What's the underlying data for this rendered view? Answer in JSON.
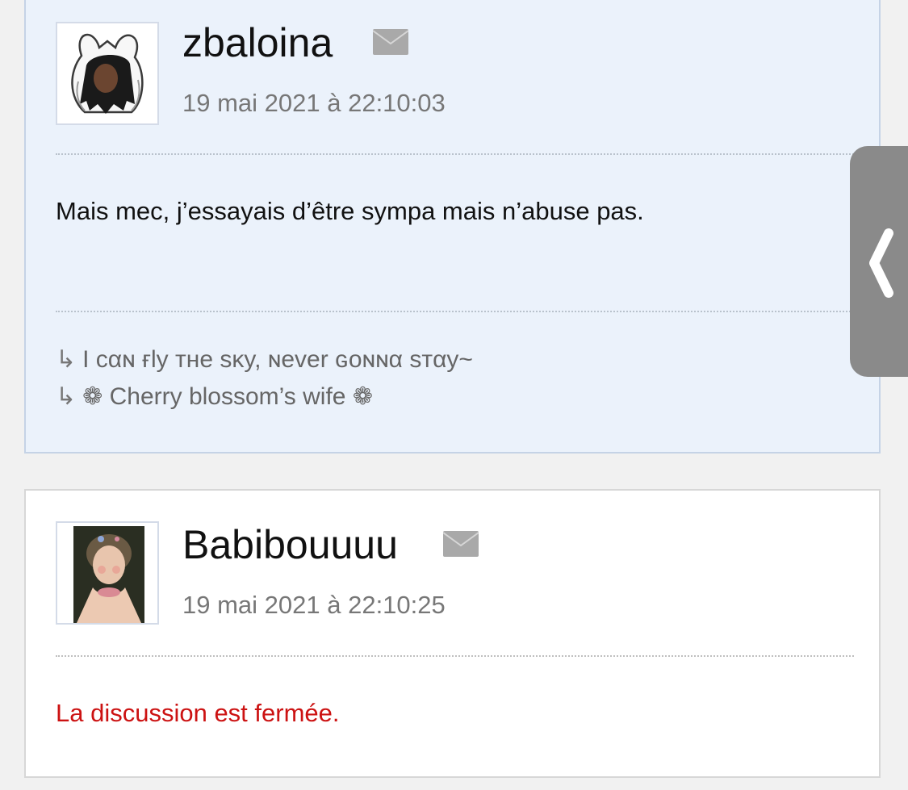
{
  "posts": [
    {
      "username": "zbaloina",
      "timestamp": "19 mai 2021 à 22:10:03",
      "message": "Mais mec, j’essayais d’être sympa mais n’abuse pas.",
      "signature": [
        "I cαɴ ғly тнe sĸy, ɴever ɢoɴɴα sтαy~",
        "❁ Cherry blossom’s wife ❁"
      ]
    },
    {
      "username": "Babibouuuu",
      "timestamp": "19 mai 2021 à 22:10:25",
      "message": "La discussion est fermée."
    }
  ],
  "signature_arrow": "↳",
  "icons": {
    "mail": "envelope-icon",
    "side_tab": "chevron-left-icon"
  },
  "colors": {
    "post_highlight_bg": "#ebf2fb",
    "closed_message": "#cc1212",
    "side_tab": "#8a8a8a"
  }
}
